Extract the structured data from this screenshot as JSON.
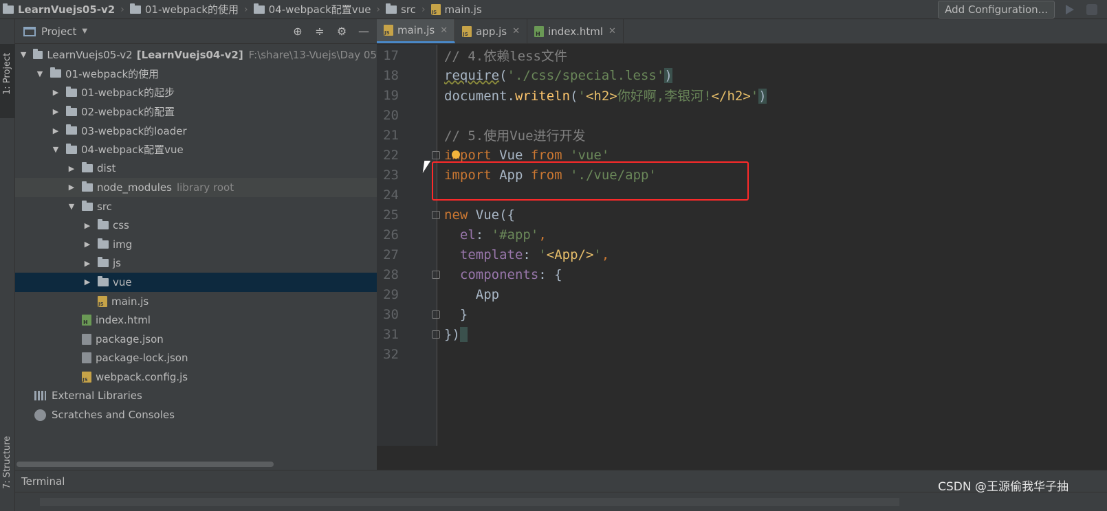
{
  "breadcrumbs": [
    "LearnVuejs05-v2",
    "01-webpack的使用",
    "04-webpack配置vue",
    "src",
    "main.js"
  ],
  "toolbar": {
    "add_configuration": "Add Configuration..."
  },
  "left_strip": {
    "project_label": "1: Project",
    "structure_label": "7: Structure"
  },
  "project_panel": {
    "title": "Project",
    "tree": [
      {
        "label": "LearnVuejs05-v2",
        "bold_suffix": "[LearnVuejs04-v2]",
        "path": "F:\\share\\13-Vuejs\\Day 05",
        "arrow": "down",
        "indent": 0,
        "icon": "folder"
      },
      {
        "label": "01-webpack的使用",
        "arrow": "down",
        "indent": 1,
        "icon": "folder"
      },
      {
        "label": "01-webpack的起步",
        "arrow": "right",
        "indent": 2,
        "icon": "folder"
      },
      {
        "label": "02-webpack的配置",
        "arrow": "right",
        "indent": 2,
        "icon": "folder"
      },
      {
        "label": "03-webpack的loader",
        "arrow": "right",
        "indent": 2,
        "icon": "folder"
      },
      {
        "label": "04-webpack配置vue",
        "arrow": "down",
        "indent": 2,
        "icon": "folder"
      },
      {
        "label": "dist",
        "arrow": "right",
        "indent": 3,
        "icon": "folder"
      },
      {
        "label": "node_modules",
        "suffix": "library root",
        "arrow": "right",
        "indent": 3,
        "icon": "folder",
        "highlight": true
      },
      {
        "label": "src",
        "arrow": "down",
        "indent": 3,
        "icon": "folder"
      },
      {
        "label": "css",
        "arrow": "right",
        "indent": 4,
        "icon": "folder"
      },
      {
        "label": "img",
        "arrow": "right",
        "indent": 4,
        "icon": "folder"
      },
      {
        "label": "js",
        "arrow": "right",
        "indent": 4,
        "icon": "folder"
      },
      {
        "label": "vue",
        "arrow": "right",
        "indent": 4,
        "icon": "folder",
        "selected": true
      },
      {
        "label": "main.js",
        "arrow": "none",
        "indent": 4,
        "icon": "js"
      },
      {
        "label": "index.html",
        "arrow": "none",
        "indent": 3,
        "icon": "html"
      },
      {
        "label": "package.json",
        "arrow": "none",
        "indent": 3,
        "icon": "json"
      },
      {
        "label": "package-lock.json",
        "arrow": "none",
        "indent": 3,
        "icon": "json"
      },
      {
        "label": "webpack.config.js",
        "arrow": "none",
        "indent": 3,
        "icon": "js"
      },
      {
        "label": "External Libraries",
        "arrow": "none",
        "indent": 0,
        "icon": "lib"
      },
      {
        "label": "Scratches and Consoles",
        "arrow": "none",
        "indent": 0,
        "icon": "scratch"
      }
    ]
  },
  "editor": {
    "tabs": [
      {
        "label": "main.js",
        "icon": "js",
        "active": true
      },
      {
        "label": "app.js",
        "icon": "js",
        "active": false
      },
      {
        "label": "index.html",
        "icon": "html",
        "active": false
      }
    ],
    "lines": [
      {
        "n": "17",
        "tokens": [
          {
            "t": "// 4.依赖less文件",
            "c": "comment"
          }
        ]
      },
      {
        "n": "18",
        "tokens": [
          {
            "t": "require",
            "c": "plain",
            "u": true
          },
          {
            "t": "(",
            "c": "plain"
          },
          {
            "t": "'./css/special.less'",
            "c": "str"
          },
          {
            "t": ")",
            "c": "plain",
            "hl": true
          }
        ]
      },
      {
        "n": "19",
        "tokens": [
          {
            "t": "document.",
            "c": "plain"
          },
          {
            "t": "writeln",
            "c": "fn"
          },
          {
            "t": "(",
            "c": "plain"
          },
          {
            "t": "'",
            "c": "str"
          },
          {
            "t": "<h2>",
            "c": "tag"
          },
          {
            "t": "你好啊,李银河!",
            "c": "str"
          },
          {
            "t": "</h2>",
            "c": "tag"
          },
          {
            "t": "'",
            "c": "str"
          },
          {
            "t": ")",
            "c": "plain",
            "hl": true
          }
        ]
      },
      {
        "n": "20",
        "tokens": []
      },
      {
        "n": "21",
        "tokens": [
          {
            "t": "// 5.使用Vue进行开发",
            "c": "comment"
          }
        ]
      },
      {
        "n": "22",
        "fold": true,
        "tokens": [
          {
            "t": "import",
            "c": "kw"
          },
          {
            "t": " Vue ",
            "c": "plain"
          },
          {
            "t": "from",
            "c": "kw"
          },
          {
            "t": " ",
            "c": "plain"
          },
          {
            "t": "'vue'",
            "c": "str"
          }
        ]
      },
      {
        "n": "23",
        "tokens": [
          {
            "t": "import",
            "c": "kw"
          },
          {
            "t": " App ",
            "c": "plain"
          },
          {
            "t": "from",
            "c": "kw"
          },
          {
            "t": " ",
            "c": "plain"
          },
          {
            "t": "'./vue/app'",
            "c": "str"
          }
        ]
      },
      {
        "n": "24",
        "tokens": []
      },
      {
        "n": "25",
        "fold": true,
        "tokens": [
          {
            "t": "new",
            "c": "kw"
          },
          {
            "t": " Vue({",
            "c": "plain"
          }
        ]
      },
      {
        "n": "26",
        "tokens": [
          {
            "t": "  ",
            "c": "plain"
          },
          {
            "t": "el",
            "c": "prop"
          },
          {
            "t": ": ",
            "c": "plain"
          },
          {
            "t": "'#app'",
            "c": "str"
          },
          {
            "t": ",",
            "c": "kw"
          }
        ]
      },
      {
        "n": "27",
        "tokens": [
          {
            "t": "  ",
            "c": "plain"
          },
          {
            "t": "template",
            "c": "prop"
          },
          {
            "t": ": ",
            "c": "plain"
          },
          {
            "t": "'",
            "c": "str"
          },
          {
            "t": "<App/>",
            "c": "tag"
          },
          {
            "t": "'",
            "c": "str"
          },
          {
            "t": ",",
            "c": "kw"
          }
        ]
      },
      {
        "n": "28",
        "fold": true,
        "tokens": [
          {
            "t": "  ",
            "c": "plain"
          },
          {
            "t": "components",
            "c": "prop"
          },
          {
            "t": ": {",
            "c": "plain"
          }
        ]
      },
      {
        "n": "29",
        "tokens": [
          {
            "t": "    App",
            "c": "plain"
          }
        ]
      },
      {
        "n": "30",
        "fold": true,
        "tokens": [
          {
            "t": "  }",
            "c": "plain"
          }
        ]
      },
      {
        "n": "31",
        "fold": true,
        "tokens": [
          {
            "t": "})",
            "c": "plain"
          },
          {
            "t": " ",
            "c": "plain",
            "hl": true
          }
        ]
      },
      {
        "n": "32",
        "tokens": []
      }
    ]
  },
  "terminal": {
    "label": "Terminal"
  },
  "watermark": "CSDN @王源偷我华子抽"
}
